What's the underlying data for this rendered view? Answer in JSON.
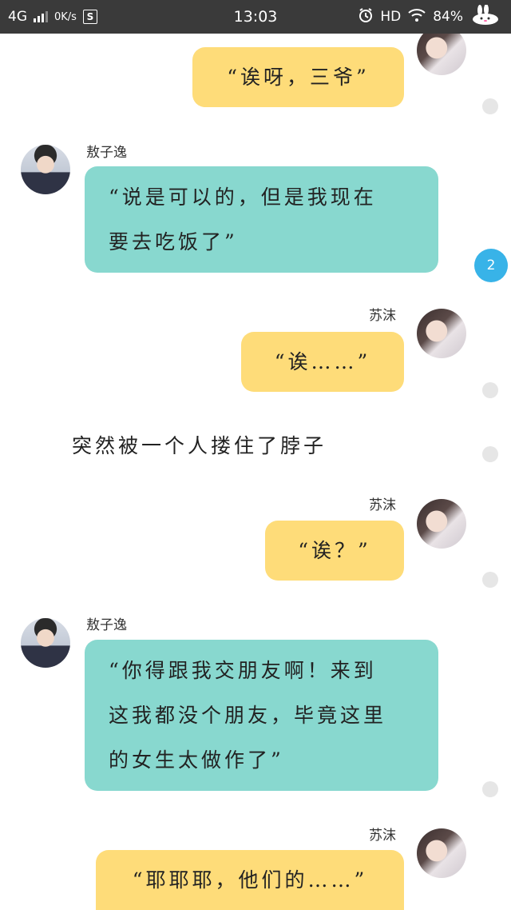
{
  "status_bar": {
    "network": "4G",
    "speed": "0K/s",
    "s_icon": "S",
    "time": "13:03",
    "hd": "HD",
    "battery": "84%"
  },
  "conversation": [
    {
      "speaker": "苏沫",
      "text": "“诶呀，三爷”"
    },
    {
      "speaker": "敖子逸",
      "text": "“说是可以的，但是我现在要去吃饭了”"
    },
    {
      "speaker": "苏沫",
      "text": "“诶……”"
    },
    {
      "narration": "突然被一个人搂住了脖子"
    },
    {
      "speaker": "苏沫",
      "text": "“诶？”"
    },
    {
      "speaker": "敖子逸",
      "text": "“你得跟我交朋友啊！来到这我都没个朋友，毕竟这里的女生太做作了”"
    },
    {
      "speaker": "苏沫",
      "text": "“耶耶耶，他们的……”"
    }
  ],
  "messages": {
    "m1": {
      "text": "“诶呀，三爷”"
    },
    "m2": {
      "name": "敖子逸",
      "line1": "“说是可以的，但是我现在",
      "line2": "要去吃饭了”"
    },
    "m3": {
      "name": "苏沫",
      "text": "“诶……”"
    },
    "narration": "突然被一个人搂住了脖子",
    "m4": {
      "name": "苏沫",
      "text": "“诶？”"
    },
    "m5": {
      "name": "敖子逸",
      "line1": "“你得跟我交朋友啊！来到",
      "line2": "这我都没个朋友，毕竟这里",
      "line3": "的女生太做作了”"
    },
    "m6": {
      "name": "苏沫",
      "text": "“耶耶耶，他们的……”"
    }
  },
  "unread_badge": "2",
  "colors": {
    "yellow_bubble": "#fedc79",
    "teal_bubble": "#88d8cf",
    "badge": "#38b3e8",
    "status_bar": "#3a3a3a"
  },
  "icons": {
    "alarm": "alarm-icon",
    "wifi": "wifi-icon",
    "battery_mascot": "bunny-icon"
  }
}
